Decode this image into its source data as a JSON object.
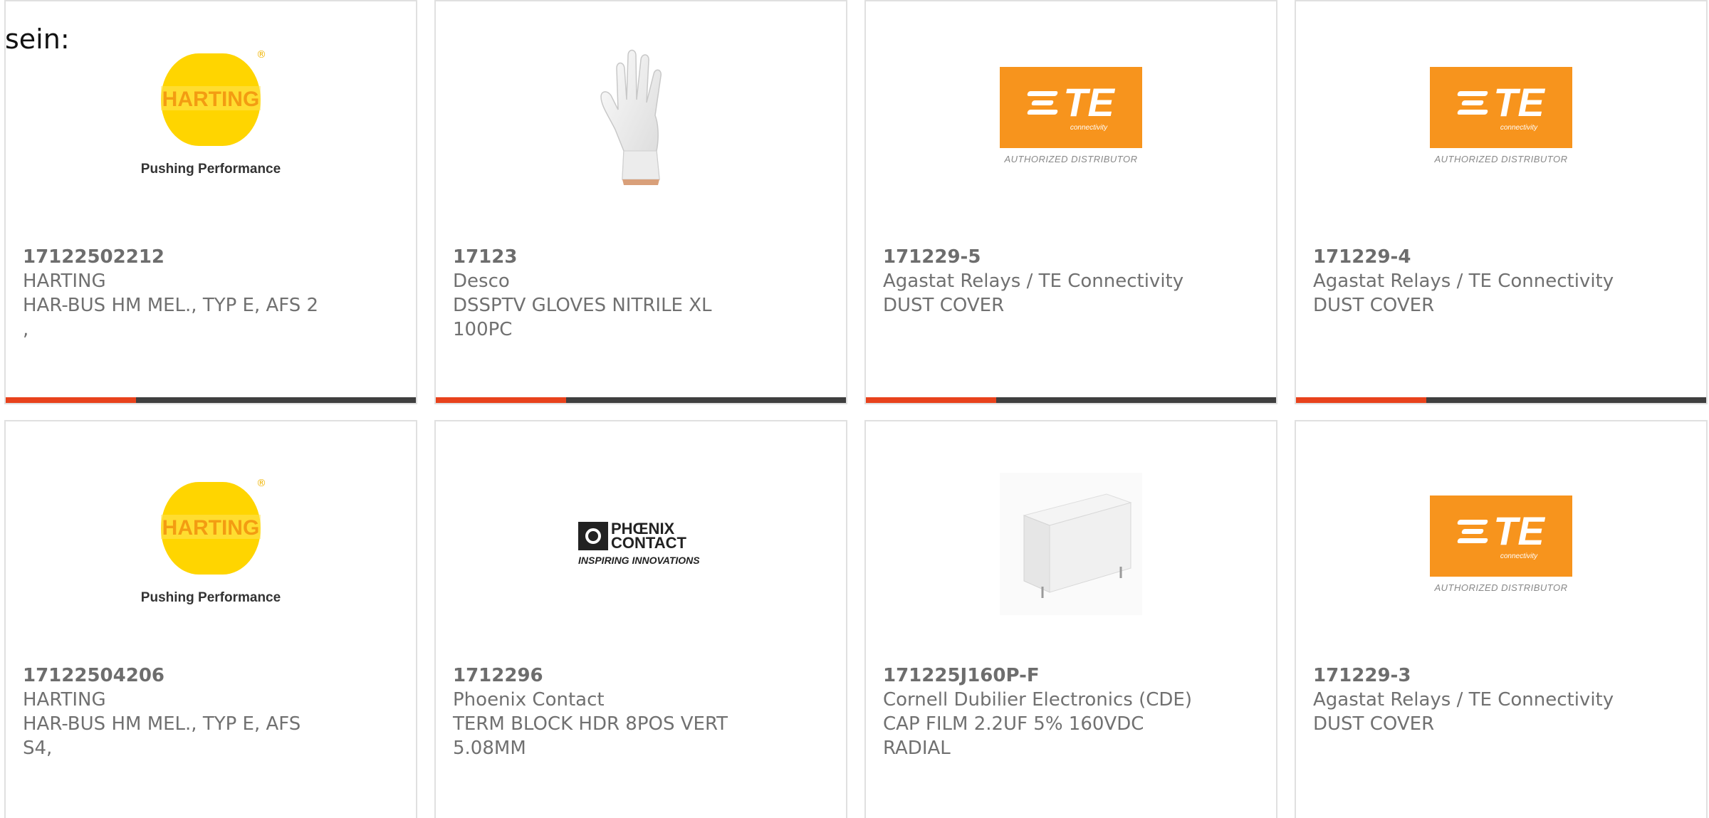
{
  "page": {
    "intro_text": "sein:"
  },
  "colors": {
    "accent": "#e8421c",
    "bar_dark": "#3f3f3f",
    "text_gray": "#707070",
    "harting_yellow": "#ffd500",
    "te_orange": "#f7941d"
  },
  "cards": [
    {
      "image": "harting-logo",
      "logo_text": "HARTING",
      "logo_tagline": "Pushing Performance",
      "part_number": "17122502212",
      "manufacturer": "HARTING",
      "description_lines": [
        "HAR-BUS HM MEL., TYP E, AFS 2",
        ","
      ]
    },
    {
      "image": "glove-photo",
      "part_number": "17123",
      "manufacturer": "Desco",
      "description_lines": [
        "DSSPTV GLOVES NITRILE XL",
        "100PC"
      ]
    },
    {
      "image": "te-connectivity-logo",
      "logo_text": "TE",
      "logo_sub": "connectivity",
      "logo_tagline": "AUTHORIZED DISTRIBUTOR",
      "part_number": "171229-5",
      "manufacturer": "Agastat Relays / TE Connectivity",
      "description_lines": [
        "DUST COVER"
      ]
    },
    {
      "image": "te-connectivity-logo",
      "logo_text": "TE",
      "logo_sub": "connectivity",
      "logo_tagline": "AUTHORIZED DISTRIBUTOR",
      "part_number": "171229-4",
      "manufacturer": "Agastat Relays / TE Connectivity",
      "description_lines": [
        "DUST COVER"
      ]
    },
    {
      "image": "harting-logo",
      "logo_text": "HARTING",
      "logo_tagline": "Pushing Performance",
      "part_number": "17122504206",
      "manufacturer": "HARTING",
      "description_lines": [
        "HAR-BUS HM MEL., TYP E, AFS",
        "S4,"
      ]
    },
    {
      "image": "phoenix-contact-logo",
      "logo_text": "PHŒNIX CONTACT",
      "logo_tagline": "INSPIRING INNOVATIONS",
      "part_number": "1712296",
      "manufacturer": "Phoenix Contact",
      "description_lines": [
        "TERM BLOCK HDR 8POS VERT",
        "5.08MM"
      ]
    },
    {
      "image": "capacitor-photo",
      "part_number": "171225J160P-F",
      "manufacturer": "Cornell Dubilier Electronics (CDE)",
      "description_lines": [
        "CAP FILM 2.2UF 5% 160VDC",
        "RADIAL"
      ]
    },
    {
      "image": "te-connectivity-logo",
      "logo_text": "TE",
      "logo_sub": "connectivity",
      "logo_tagline": "AUTHORIZED DISTRIBUTOR",
      "part_number": "171229-3",
      "manufacturer": "Agastat Relays / TE Connectivity",
      "description_lines": [
        "DUST COVER"
      ]
    }
  ]
}
